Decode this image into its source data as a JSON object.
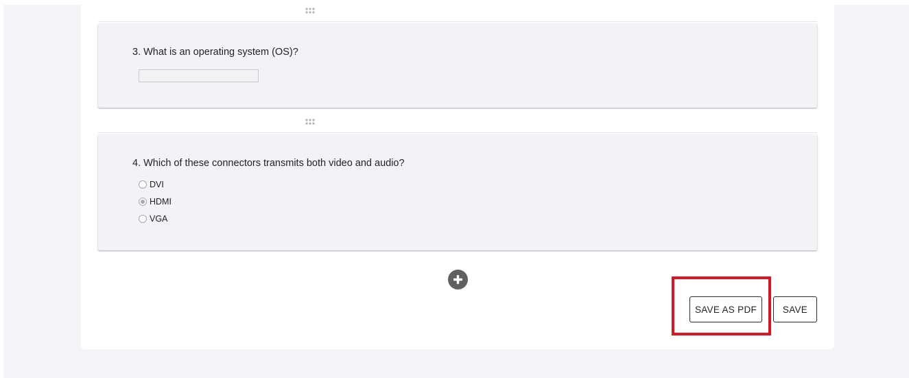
{
  "questions": [
    {
      "title": "3. What is an operating system (OS)?",
      "type": "text",
      "answer_value": ""
    },
    {
      "title": "4. Which of these connectors transmits both video and audio?",
      "type": "radio",
      "options": [
        {
          "label": "DVI",
          "checked": false
        },
        {
          "label": "HDMI",
          "checked": true
        },
        {
          "label": "VGA",
          "checked": false
        }
      ]
    }
  ],
  "icons": {
    "drag_handle": "drag-handle-icon",
    "add": "plus-icon"
  },
  "actions": {
    "save_as_pdf_label": "SAVE AS PDF",
    "save_label": "SAVE"
  },
  "annotation": {
    "highlight_target": "save-as-pdf-button",
    "highlight_color": "#e0131f"
  },
  "colors": {
    "page_background": "#f4f3f8",
    "card_background": "#f3f2f7",
    "add_button": "#606060"
  }
}
